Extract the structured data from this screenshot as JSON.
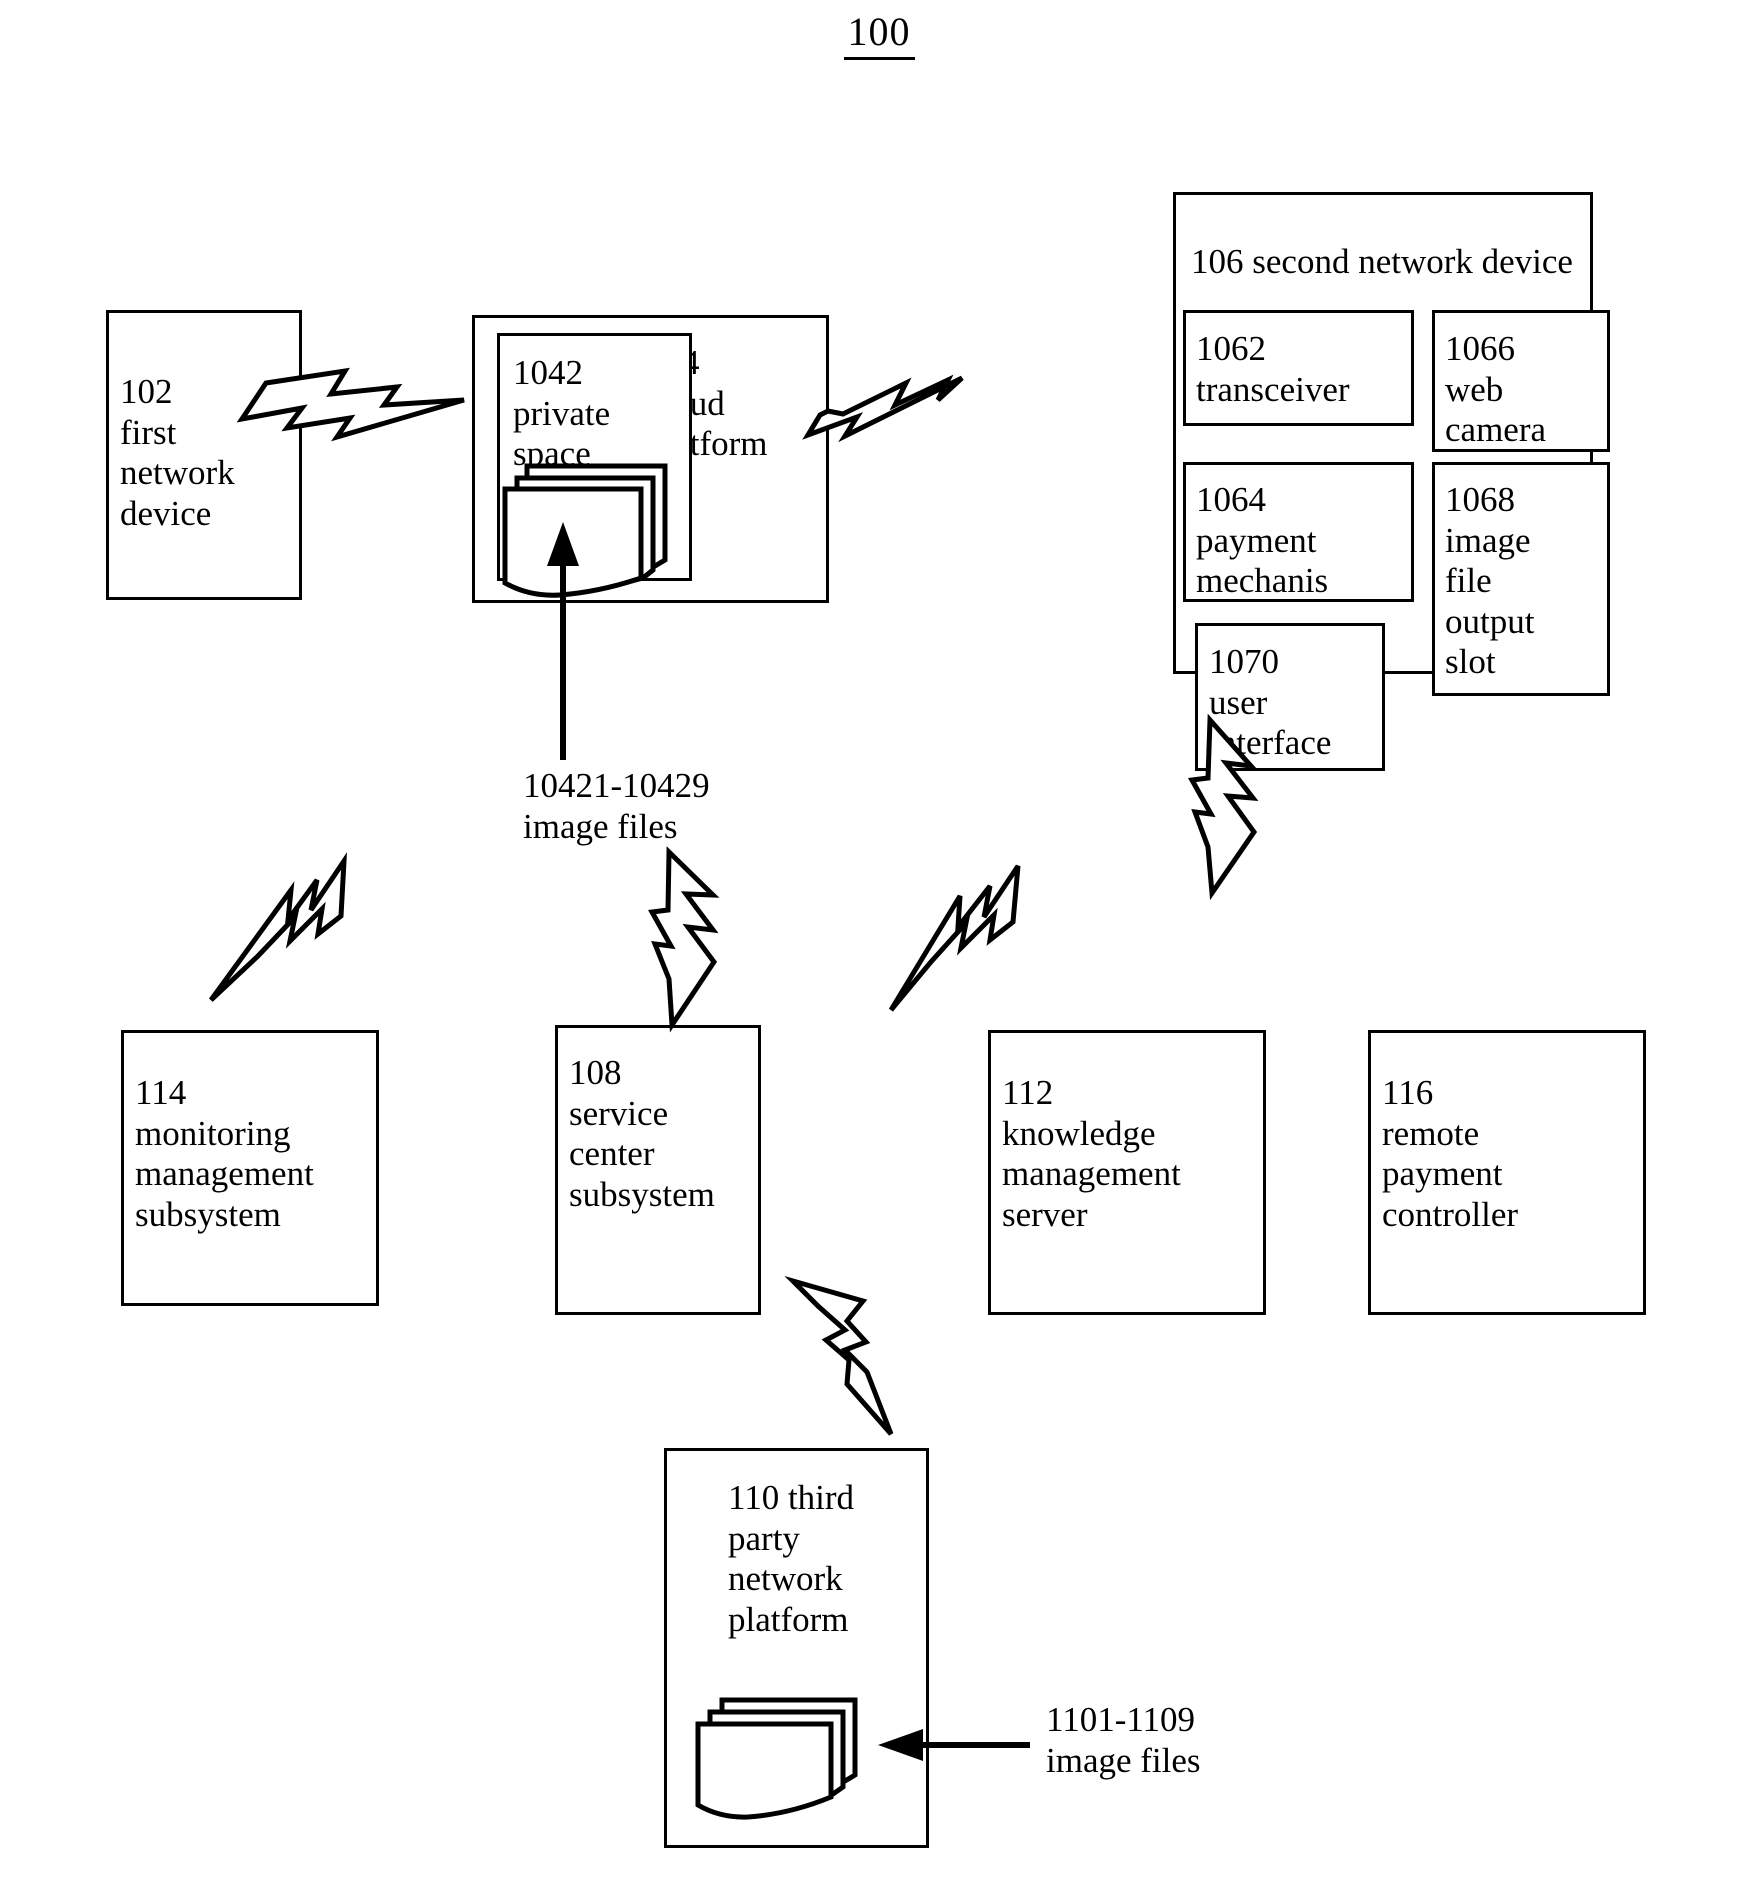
{
  "figure": {
    "number": "100"
  },
  "boxes": {
    "first_network_device": "102\nfirst\nnetwork\ndevice",
    "cloud_platform": "104\ncloud\nplatform",
    "private_space": "1042\nprivate\nspace",
    "second_network_device": "106 second network device",
    "transceiver": "1062\ntransceiver",
    "web_camera": "1066\nweb\ncamera",
    "payment_mechanism": "1064\npayment\nmechanis",
    "image_file_output_slot": "1068\nimage\nfile\noutput\nslot",
    "user_interface": "1070\nuser\ninterface",
    "monitoring_management_subsystem": "114\nmonitoring\nmanagement\nsubsystem",
    "service_center_subsystem": "108\nservice\ncenter\nsubsystem",
    "knowledge_management_server": "112\nknowledge\nmanagement\nserver",
    "remote_payment_controller": "116\nremote\npayment\ncontroller",
    "third_party_network_platform": "110 third\nparty\nnetwork\nplatform"
  },
  "callouts": {
    "cloud_image_files": "10421-10429\nimage files",
    "third_party_image_files": "1101-1109\nimage files"
  },
  "icons": {
    "file_stack_cloud": "file-stack-icon",
    "file_stack_third_party": "file-stack-icon",
    "bolt_102_to_104": "lightning-bolt-icon",
    "bolt_104_to_106": "lightning-bolt-icon",
    "bolt_114_to_104": "lightning-bolt-icon",
    "bolt_108_to_104": "lightning-bolt-icon",
    "bolt_112_to_106": "lightning-bolt-icon",
    "bolt_116_to_106": "lightning-bolt-icon",
    "bolt_108_to_110": "lightning-bolt-icon",
    "arrow_cloud_files": "up-arrow-icon",
    "arrow_third_party_files": "left-arrow-icon"
  },
  "colors": {
    "ink": "#000000",
    "paper": "#ffffff"
  }
}
